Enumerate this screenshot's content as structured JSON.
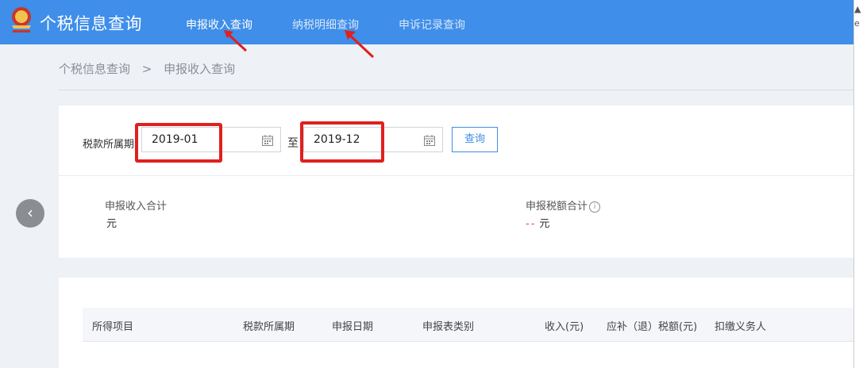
{
  "header": {
    "title": "个税信息查询",
    "tabs": [
      {
        "label": "申报收入查询"
      },
      {
        "label": "纳税明细查询"
      },
      {
        "label": "申诉记录查询"
      }
    ]
  },
  "breadcrumb": {
    "root": "个税信息查询",
    "separator": ">",
    "current": "申报收入查询"
  },
  "filter": {
    "period_label": "税款所属期",
    "start_value": "2019-01",
    "to_label": "至",
    "end_value": "2019-12",
    "query_label": "查询"
  },
  "summary": {
    "income_label": "申报收入合计",
    "income_unit": "元",
    "tax_label": "申报税额合计",
    "tax_value": "--",
    "tax_unit": "元",
    "info_glyph": "i"
  },
  "table": {
    "columns": [
      "所得项目",
      "税款所属期",
      "申报日期",
      "申报表类别",
      "收入(元)",
      "应补（退）税额(元)",
      "扣缴义务人"
    ]
  },
  "colors": {
    "header_bg": "#3f8ee9",
    "highlight": "#e0201e"
  },
  "icons": {
    "back": "chevron-left-icon",
    "calendar": "calendar-icon",
    "emblem": "tax-emblem-icon",
    "info": "info-icon"
  }
}
